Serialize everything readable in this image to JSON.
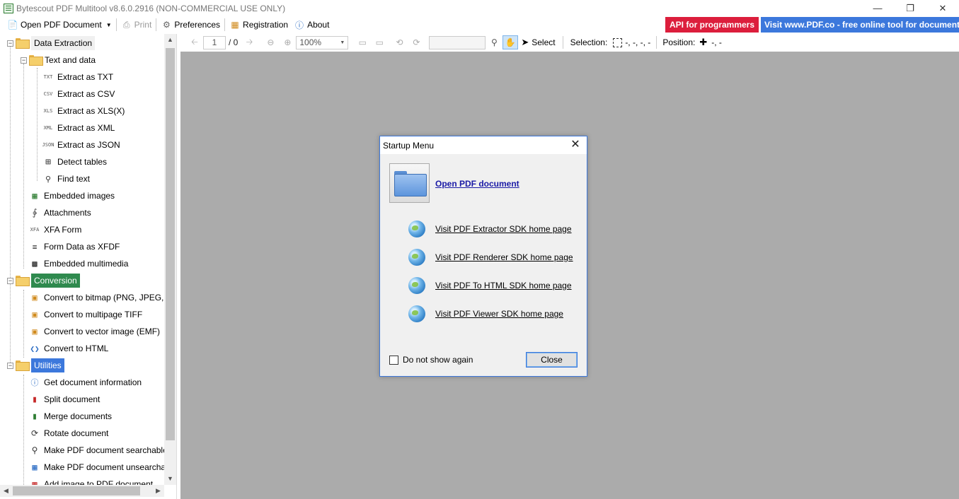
{
  "window": {
    "title": "Bytescout PDF Multitool v8.6.0.2916 (NON-COMMERCIAL USE ONLY)",
    "minimize": "—",
    "restore": "❐",
    "close": "✕"
  },
  "toolbar": {
    "open_label": "Open PDF Document",
    "print_label": "Print",
    "preferences_label": "Preferences",
    "registration_label": "Registration",
    "about_label": "About",
    "promo_api": "API for programmers",
    "promo_visit": "Visit www.PDF.co - free online tool for documents"
  },
  "tree": {
    "data_extraction": "Data Extraction",
    "text_and_data": "Text and data",
    "extract_txt": "Extract as TXT",
    "extract_csv": "Extract as CSV",
    "extract_xls": "Extract as XLS(X)",
    "extract_xml": "Extract as XML",
    "extract_json": "Extract as JSON",
    "detect_tables": "Detect tables",
    "find_text": "Find text",
    "embedded_images": "Embedded images",
    "attachments": "Attachments",
    "xfa_form": "XFA Form",
    "form_data_xfdf": "Form Data as XFDF",
    "embedded_multimedia": "Embedded multimedia",
    "conversion": "Conversion",
    "convert_bitmap": "Convert to bitmap (PNG, JPEG, ...",
    "convert_tiff": "Convert to multipage TIFF",
    "convert_vector": "Convert to vector image (EMF)",
    "convert_html": "Convert to HTML",
    "utilities": "Utilities",
    "get_info": "Get document information",
    "split": "Split document",
    "merge": "Merge documents",
    "rotate": "Rotate document",
    "make_searchable": "Make PDF document searchable",
    "make_unsearchable": "Make PDF document unsearchable",
    "add_image": "Add image to PDF document",
    "icon_txt": "TXT",
    "icon_csv": "CSV",
    "icon_xls": "XLS",
    "icon_xml": "XML",
    "icon_json": "JSON",
    "icon_xfa": "XFA"
  },
  "viewer": {
    "page_value": "1",
    "page_total": "/ 0",
    "zoom_value": "100%",
    "select_label": "Select",
    "selection_label": "Selection:",
    "selection_value": "-, -, -, -",
    "position_label": "Position:",
    "position_value": "-, -"
  },
  "dialog": {
    "title": "Startup Menu",
    "open_link": "Open PDF document",
    "links": [
      "Visit PDF Extractor SDK home page",
      "Visit PDF Renderer SDK home page",
      "Visit PDF To HTML SDK home page",
      "Visit PDF Viewer SDK home page"
    ],
    "do_not_show": "Do not show again",
    "close_button": "Close"
  },
  "colors": {
    "promo_red": "#dc1e3c",
    "promo_blue": "#3c78dc",
    "conversion_highlight": "#2f8a4e",
    "utilities_highlight": "#3c78dc",
    "canvas": "#ababab"
  }
}
